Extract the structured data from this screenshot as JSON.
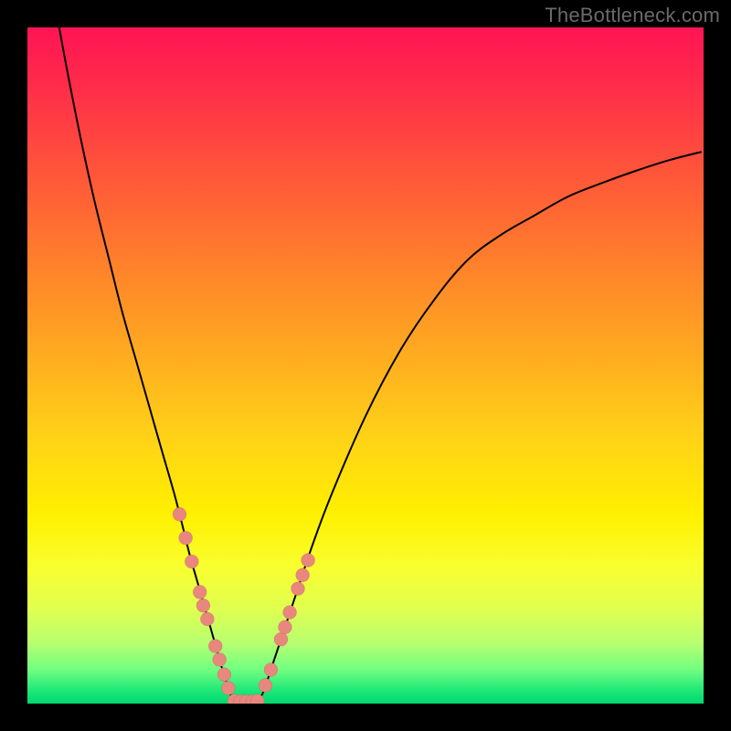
{
  "watermark": "TheBottleneck.com",
  "colors": {
    "background": "#000000",
    "gradient_top": "#ff1454",
    "gradient_bottom": "#00d870",
    "curve": "#000000",
    "dots": "#e9867e"
  },
  "chart_data": {
    "type": "line",
    "title": "",
    "xlabel": "",
    "ylabel": "",
    "xlim": [
      0,
      100
    ],
    "ylim": [
      0,
      100
    ],
    "grid": false,
    "series": [
      {
        "name": "left-arm",
        "x": [
          4.7,
          6,
          8,
          10,
          12,
          14,
          16,
          18,
          20,
          22,
          24,
          25,
          26,
          27,
          28,
          29,
          30,
          30.3
        ],
        "values": [
          100,
          93,
          83,
          74,
          66,
          58,
          51,
          44,
          37,
          30,
          22,
          18.5,
          15,
          11.5,
          8,
          4.5,
          1.5,
          0.4
        ]
      },
      {
        "name": "right-arm",
        "x": [
          34.2,
          35,
          36,
          37,
          38,
          39,
          40,
          42,
          45,
          50,
          55,
          60,
          65,
          70,
          75,
          80,
          85,
          90,
          95,
          99.7
        ],
        "values": [
          0.4,
          2,
          5,
          8,
          11,
          14,
          17,
          23,
          31,
          42.5,
          52,
          59.5,
          65.5,
          69.3,
          72.2,
          75,
          77,
          78.8,
          80.4,
          81.6
        ]
      },
      {
        "name": "valley-floor",
        "x": [
          30.3,
          31,
          32,
          32.5,
          33,
          34,
          34.2
        ],
        "values": [
          0.4,
          0.25,
          0.2,
          0.2,
          0.2,
          0.25,
          0.4
        ]
      }
    ],
    "annotations": {
      "dots_left_arm": [
        {
          "x": 22.5,
          "y": 28
        },
        {
          "x": 23.4,
          "y": 24.5
        },
        {
          "x": 24.3,
          "y": 21
        },
        {
          "x": 25.5,
          "y": 16.5
        },
        {
          "x": 26.0,
          "y": 14.5
        },
        {
          "x": 26.6,
          "y": 12.5
        },
        {
          "x": 27.8,
          "y": 8.5
        },
        {
          "x": 28.4,
          "y": 6.5
        },
        {
          "x": 29.1,
          "y": 4.3
        },
        {
          "x": 29.7,
          "y": 2.3
        }
      ],
      "dots_valley": [
        {
          "x": 30.6,
          "y": 0.4
        },
        {
          "x": 31.5,
          "y": 0.3
        },
        {
          "x": 32.4,
          "y": 0.3
        },
        {
          "x": 33.3,
          "y": 0.3
        },
        {
          "x": 34.0,
          "y": 0.4
        }
      ],
      "dots_right_arm": [
        {
          "x": 35.2,
          "y": 2.7
        },
        {
          "x": 36.0,
          "y": 5.0
        },
        {
          "x": 37.5,
          "y": 9.5
        },
        {
          "x": 38.1,
          "y": 11.3
        },
        {
          "x": 38.8,
          "y": 13.5
        },
        {
          "x": 40.0,
          "y": 17.0
        },
        {
          "x": 40.7,
          "y": 19.0
        },
        {
          "x": 41.5,
          "y": 21.2
        }
      ]
    }
  }
}
